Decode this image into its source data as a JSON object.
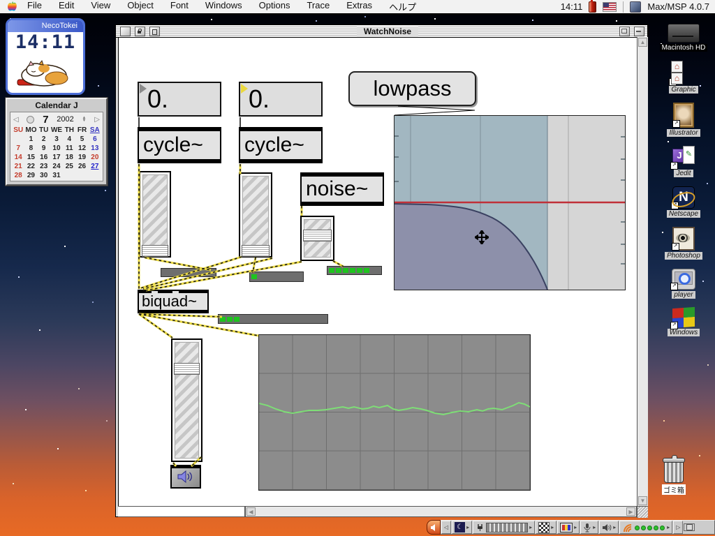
{
  "menu_bar": {
    "items": [
      {
        "key": "file",
        "label": "File"
      },
      {
        "key": "edit",
        "label": "Edit"
      },
      {
        "key": "view",
        "label": "View"
      },
      {
        "key": "object",
        "label": "Object"
      },
      {
        "key": "font",
        "label": "Font"
      },
      {
        "key": "windows",
        "label": "Windows"
      },
      {
        "key": "options",
        "label": "Options"
      },
      {
        "key": "trace",
        "label": "Trace"
      },
      {
        "key": "extras",
        "label": "Extras"
      },
      {
        "key": "help",
        "label": "ヘルプ"
      }
    ],
    "clock": "14:11",
    "app_name": "Max/MSP 4.0.7"
  },
  "neco": {
    "title": "NecoTokei",
    "time": "14:11"
  },
  "calendar": {
    "title": "Calendar J",
    "month": "7",
    "year": "2002",
    "headers": [
      {
        "t": "SU",
        "c": "r"
      },
      {
        "t": "MO",
        "c": "k"
      },
      {
        "t": "TU",
        "c": "k"
      },
      {
        "t": "WE",
        "c": "k"
      },
      {
        "t": "TH",
        "c": "k"
      },
      {
        "t": "FR",
        "c": "k"
      },
      {
        "t": "SA",
        "c": "b"
      }
    ],
    "cells": [
      {
        "t": "",
        "c": "e"
      },
      {
        "t": "1",
        "c": "k"
      },
      {
        "t": "2",
        "c": "k"
      },
      {
        "t": "3",
        "c": "k"
      },
      {
        "t": "4",
        "c": "k"
      },
      {
        "t": "5",
        "c": "k"
      },
      {
        "t": "6",
        "c": "b"
      },
      {
        "t": "7",
        "c": "r"
      },
      {
        "t": "8",
        "c": "k"
      },
      {
        "t": "9",
        "c": "k"
      },
      {
        "t": "10",
        "c": "k"
      },
      {
        "t": "11",
        "c": "k"
      },
      {
        "t": "12",
        "c": "k"
      },
      {
        "t": "13",
        "c": "b"
      },
      {
        "t": "14",
        "c": "r"
      },
      {
        "t": "15",
        "c": "k"
      },
      {
        "t": "16",
        "c": "k"
      },
      {
        "t": "17",
        "c": "k"
      },
      {
        "t": "18",
        "c": "k"
      },
      {
        "t": "19",
        "c": "k"
      },
      {
        "t": "20",
        "c": "r"
      },
      {
        "t": "21",
        "c": "r"
      },
      {
        "t": "22",
        "c": "k"
      },
      {
        "t": "23",
        "c": "k"
      },
      {
        "t": "24",
        "c": "k"
      },
      {
        "t": "25",
        "c": "k"
      },
      {
        "t": "26",
        "c": "k"
      },
      {
        "t": "27",
        "c": "t"
      },
      {
        "t": "28",
        "c": "r"
      },
      {
        "t": "29",
        "c": "k"
      },
      {
        "t": "30",
        "c": "k"
      },
      {
        "t": "31",
        "c": "k"
      },
      {
        "t": "",
        "c": "e"
      },
      {
        "t": "",
        "c": "e"
      },
      {
        "t": "",
        "c": "e"
      }
    ]
  },
  "window": {
    "title": "WatchNoise"
  },
  "patch": {
    "numbox1": "0.",
    "numbox2": "0.",
    "cycle1": "cycle~",
    "cycle2": "cycle~",
    "comment": "lowpass",
    "noise": "noise~",
    "biquad": "biquad~",
    "meters": [
      {
        "segments": 0
      },
      {
        "segments": 1
      },
      {
        "segments": 6
      },
      {
        "segments": 3
      }
    ]
  },
  "desktop_icons": [
    {
      "kind": "hd",
      "label": "Macintosh HD"
    },
    {
      "kind": "graphic",
      "label": "Graphic"
    },
    {
      "kind": "illustrator",
      "label": "Illustrator"
    },
    {
      "kind": "jedit",
      "label": "Jedit"
    },
    {
      "kind": "netscape",
      "label": "Netscape"
    },
    {
      "kind": "photoshop",
      "label": "Photoshop"
    },
    {
      "kind": "player",
      "label": "player"
    },
    {
      "kind": "windows",
      "label": "Windows"
    }
  ],
  "trash": {
    "label": "ゴミ箱"
  },
  "control_strip": {
    "airport_dots": 5
  },
  "colors": {
    "signal_cord": "#ead942",
    "filtergraph_band": "#a2b7c1",
    "filtergraph_fill": "#8d90aa",
    "filtergraph_line": "#c03038",
    "meter_green": "#1ec41e",
    "scope_wave": "#7ede76",
    "desktop_orange": "#e86a24"
  }
}
